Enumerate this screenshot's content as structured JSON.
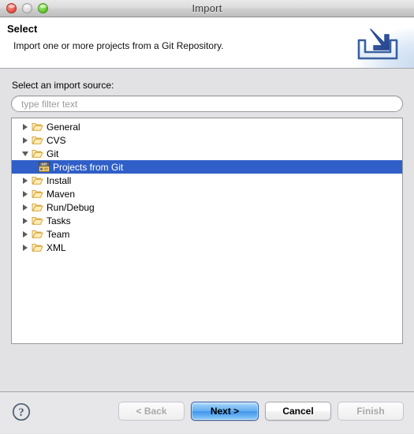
{
  "window": {
    "title": "Import",
    "controls": [
      {
        "name": "close",
        "color": "#e24b3f"
      },
      {
        "name": "minimize",
        "color": "#d5d5d5"
      },
      {
        "name": "zoom",
        "color": "#59c128"
      }
    ]
  },
  "header": {
    "title": "Select",
    "description": "Import one or more projects from a Git Repository.",
    "icon": "import-banner-icon"
  },
  "main": {
    "source_label": "Select an import source:",
    "filter": {
      "value": "",
      "placeholder": "type filter text"
    },
    "tree": {
      "selection_color": "#2f5fc7",
      "items": [
        {
          "label": "General",
          "level": 0,
          "icon": "folder-icon",
          "state": "collapsed",
          "selected": false
        },
        {
          "label": "CVS",
          "level": 0,
          "icon": "folder-icon",
          "state": "collapsed",
          "selected": false
        },
        {
          "label": "Git",
          "level": 0,
          "icon": "folder-icon",
          "state": "expanded",
          "selected": false
        },
        {
          "label": "Projects from Git",
          "level": 1,
          "icon": "git-icon",
          "state": "leaf",
          "selected": true
        },
        {
          "label": "Install",
          "level": 0,
          "icon": "folder-icon",
          "state": "collapsed",
          "selected": false
        },
        {
          "label": "Maven",
          "level": 0,
          "icon": "folder-icon",
          "state": "collapsed",
          "selected": false
        },
        {
          "label": "Run/Debug",
          "level": 0,
          "icon": "folder-icon",
          "state": "collapsed",
          "selected": false
        },
        {
          "label": "Tasks",
          "level": 0,
          "icon": "folder-icon",
          "state": "collapsed",
          "selected": false
        },
        {
          "label": "Team",
          "level": 0,
          "icon": "folder-icon",
          "state": "collapsed",
          "selected": false
        },
        {
          "label": "XML",
          "level": 0,
          "icon": "folder-icon",
          "state": "collapsed",
          "selected": false
        }
      ]
    }
  },
  "footer": {
    "help_icon": "help-question-icon",
    "buttons": {
      "back": {
        "label": "< Back",
        "enabled": false,
        "default": false
      },
      "next": {
        "label": "Next >",
        "enabled": true,
        "default": true
      },
      "cancel": {
        "label": "Cancel",
        "enabled": true,
        "default": false
      },
      "finish": {
        "label": "Finish",
        "enabled": false,
        "default": false
      }
    }
  }
}
